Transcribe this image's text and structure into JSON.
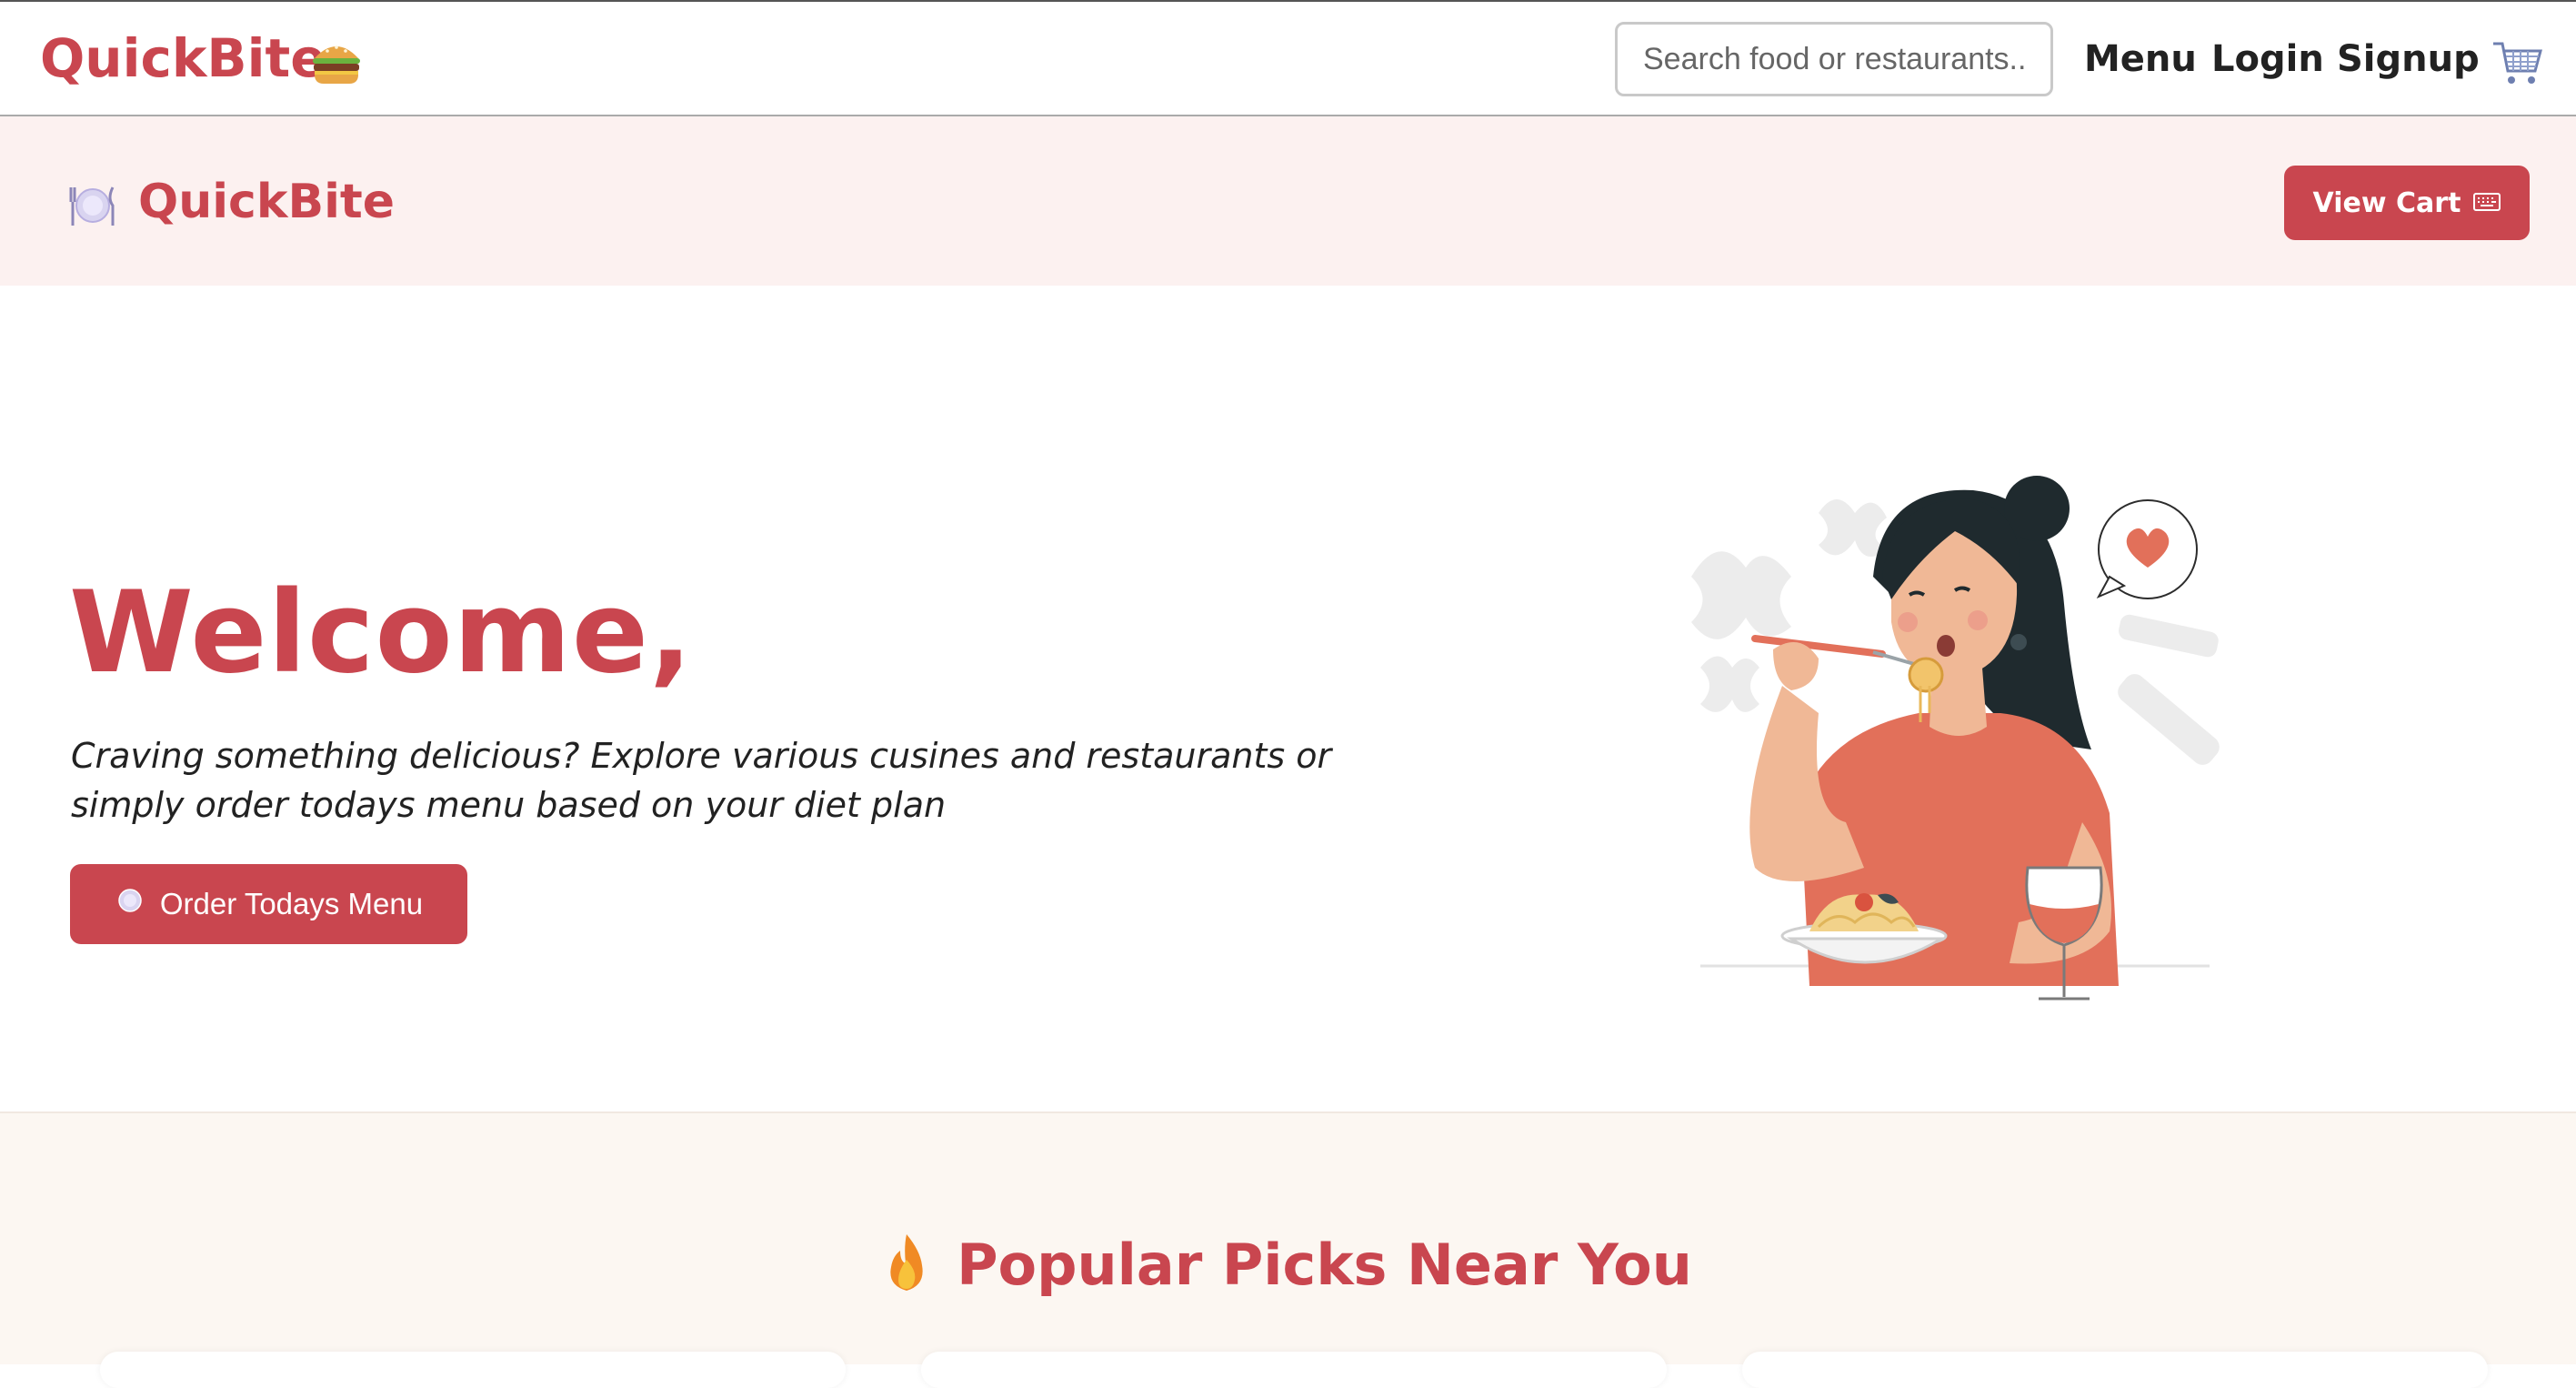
{
  "navbar": {
    "brand": "QuickBite",
    "brand_emoji_icon": "burger-icon",
    "search_placeholder": "Search food or restaurants...",
    "links": [
      "Menu",
      "Login",
      "Signup"
    ],
    "cart_icon": "shopping-cart-icon"
  },
  "subheader": {
    "icon": "plate-cutlery-icon",
    "brand": "QuickBite",
    "view_cart_label": "View Cart",
    "view_cart_icon": "keyboard-icon"
  },
  "hero": {
    "title": "Welcome,",
    "text": "Craving something delicious? Explore various cusines and restaurants or simply order todays menu based on your diet plan",
    "button_label": "Order Todays Menu",
    "button_icon": "plate-cutlery-icon",
    "illustration": "woman-eating-pasta-illustration"
  },
  "popular": {
    "title": "Popular Picks Near You",
    "title_icon": "fire-icon"
  },
  "colors": {
    "accent": "#c9464f",
    "subheader_bg": "#fcf1f0",
    "section_bg": "#fcf7f2"
  }
}
